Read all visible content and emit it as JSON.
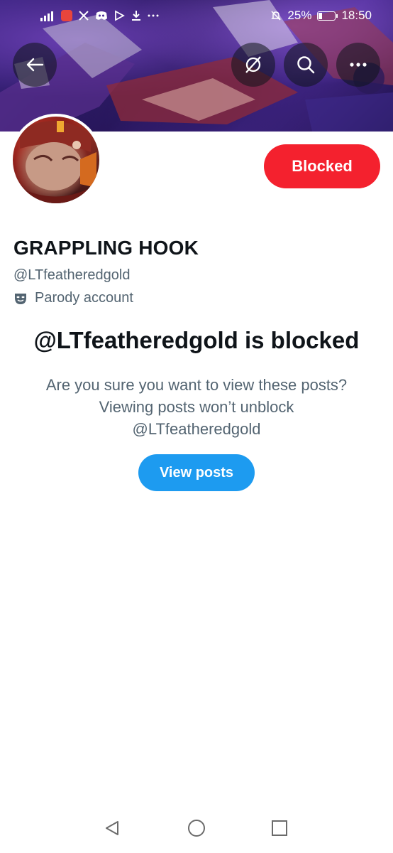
{
  "status_bar": {
    "time": "18:50",
    "battery_percent": "25%",
    "battery_level": 0.25,
    "icons": [
      "signal-icon",
      "app-badge-icon",
      "x-icon",
      "discord-icon",
      "play-icon",
      "download-icon",
      "more-dots-icon",
      "mute-bell-icon",
      "battery-icon"
    ]
  },
  "header": {
    "back_icon": "arrow-left-icon",
    "grok_icon": "grok-icon",
    "search_icon": "search-icon",
    "more_icon": "more-icon"
  },
  "profile": {
    "display_name": "GRAPPLING HOOK",
    "handle": "@LTfeatheredgold",
    "label": "Parody account",
    "label_icon": "mask-icon",
    "blocked_button": "Blocked"
  },
  "blocked_notice": {
    "title": "@LTfeatheredgold is blocked",
    "line1": "Are you sure you want to view these posts?",
    "line2": "Viewing posts won’t unblock",
    "line3": "@LTfeatheredgold",
    "view_button": "View posts"
  },
  "system_nav": {
    "back": "triangle-back-icon",
    "home": "circle-home-icon",
    "recents": "square-recents-icon"
  },
  "colors": {
    "blocked_red": "#f4212e",
    "view_blue": "#1d9bf0",
    "secondary_text": "#536471",
    "primary_text": "#0f1419"
  }
}
